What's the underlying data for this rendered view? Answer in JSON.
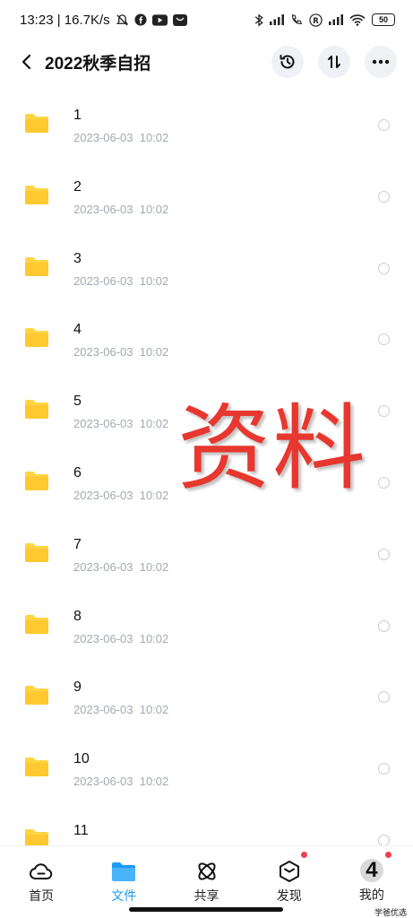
{
  "status_bar": {
    "time_speed": "13:23 | 16.7K/s",
    "battery": "50"
  },
  "header": {
    "title": "2022秋季自招"
  },
  "files": [
    {
      "name": "1",
      "date": "2023-06-03  10:02"
    },
    {
      "name": "2",
      "date": "2023-06-03  10:02"
    },
    {
      "name": "3",
      "date": "2023-06-03  10:02"
    },
    {
      "name": "4",
      "date": "2023-06-03  10:02"
    },
    {
      "name": "5",
      "date": "2023-06-03  10:02"
    },
    {
      "name": "6",
      "date": "2023-06-03  10:02"
    },
    {
      "name": "7",
      "date": "2023-06-03  10:02"
    },
    {
      "name": "8",
      "date": "2023-06-03  10:02"
    },
    {
      "name": "9",
      "date": "2023-06-03  10:02"
    },
    {
      "name": "10",
      "date": "2023-06-03  10:02"
    },
    {
      "name": "11",
      "date": ""
    }
  ],
  "watermark": "资料",
  "nav": {
    "home": "首页",
    "files": "文件",
    "share": "共享",
    "discover": "发现",
    "mine": "我的",
    "avatar_text": "4"
  },
  "corner_logo": "学爸优选",
  "colors": {
    "accent": "#1e9bf5",
    "folder": "#fdd444",
    "badge": "#ec3f52",
    "watermark": "#e8372f"
  }
}
